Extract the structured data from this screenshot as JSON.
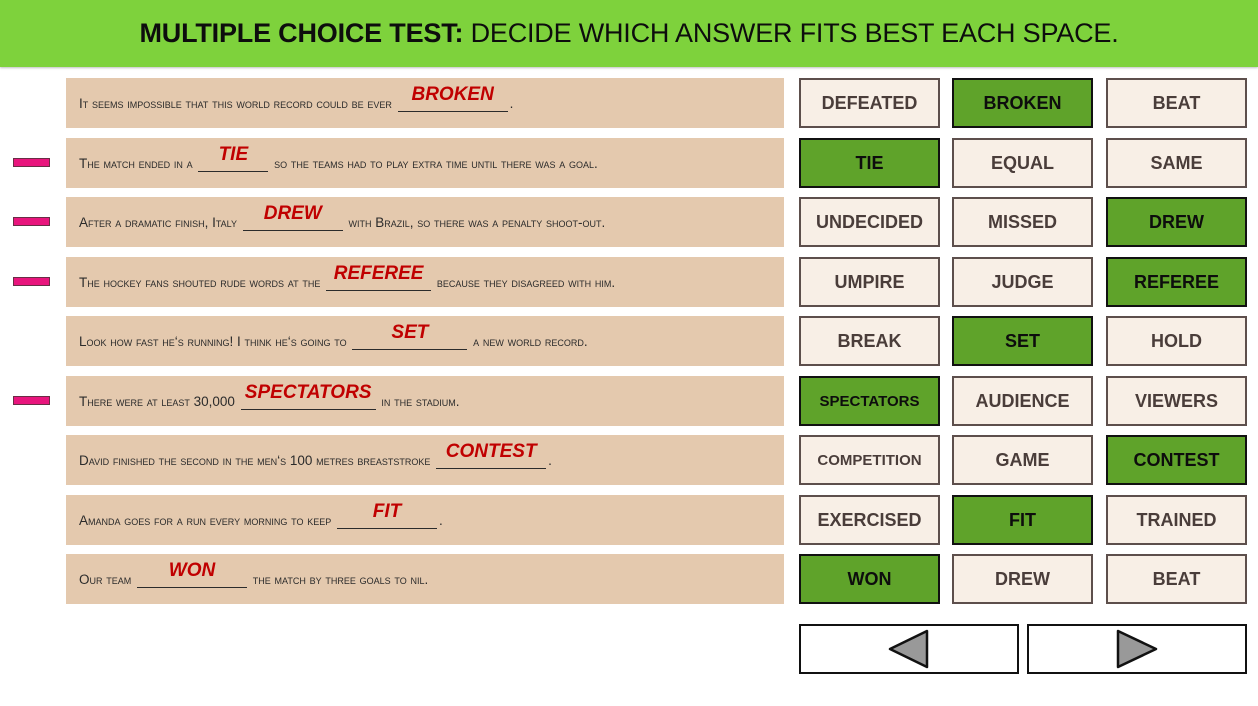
{
  "header": {
    "title_bold": "MULTIPLE CHOICE TEST:",
    "title_rest": " DECIDE WHICH ANSWER FITS BEST EACH SPACE."
  },
  "colors": {
    "header_bg": "#7ed23c",
    "question_bg": "#e4c9ae",
    "answer_text": "#c00000",
    "correct_option_bg": "#5fa32a",
    "option_bg": "#f8efe6",
    "marker": "#e8157d"
  },
  "questions": [
    {
      "before": "It seems impossible that this world record could be ever ",
      "answer": "BROKEN",
      "after": ".",
      "marked": false,
      "options": [
        {
          "label": "DEFEATED",
          "correct": false
        },
        {
          "label": "BROKEN",
          "correct": true
        },
        {
          "label": "BEAT",
          "correct": false
        }
      ]
    },
    {
      "before": "The match ended in a ",
      "answer": "TIE",
      "after": " so the teams had to play extra time until there was a goal.",
      "marked": true,
      "options": [
        {
          "label": "TIE",
          "correct": true
        },
        {
          "label": "EQUAL",
          "correct": false
        },
        {
          "label": "SAME",
          "correct": false
        }
      ]
    },
    {
      "before": "After a dramatic finish, Italy ",
      "answer": "DREW",
      "after": " with Brazil, so there was a penalty shoot-out.",
      "marked": true,
      "options": [
        {
          "label": "UNDECIDED",
          "correct": false
        },
        {
          "label": "MISSED",
          "correct": false
        },
        {
          "label": "DREW",
          "correct": true
        }
      ]
    },
    {
      "before": "The hockey fans shouted rude words at the ",
      "answer": "REFEREE",
      "after": " because they disagreed with him.",
      "marked": true,
      "options": [
        {
          "label": "UMPIRE",
          "correct": false
        },
        {
          "label": "JUDGE",
          "correct": false
        },
        {
          "label": "REFEREE",
          "correct": true
        }
      ]
    },
    {
      "before": "Look how fast he‘s running! I think he‘s going to ",
      "answer": "SET",
      "after": " a new world record.",
      "marked": false,
      "options": [
        {
          "label": "BREAK",
          "correct": false
        },
        {
          "label": "SET",
          "correct": true
        },
        {
          "label": "HOLD",
          "correct": false
        }
      ]
    },
    {
      "before": "There were at least 30,000 ",
      "answer": "SPECTATORS",
      "after": " in the stadium.",
      "marked": true,
      "options": [
        {
          "label": "SPECTATORS",
          "correct": true
        },
        {
          "label": "AUDIENCE",
          "correct": false
        },
        {
          "label": "VIEWERS",
          "correct": false
        }
      ]
    },
    {
      "before": "David finished the second in the men‘s 100 metres breaststroke ",
      "answer": "CONTEST",
      "after": ".",
      "marked": false,
      "options": [
        {
          "label": "COMPETITION",
          "correct": false
        },
        {
          "label": "GAME",
          "correct": false
        },
        {
          "label": "CONTEST",
          "correct": true
        }
      ]
    },
    {
      "before": "Amanda goes for a run every morning to keep ",
      "answer": "FIT",
      "after": ".",
      "marked": false,
      "options": [
        {
          "label": "EXERCISED",
          "correct": false
        },
        {
          "label": "FIT",
          "correct": true
        },
        {
          "label": "TRAINED",
          "correct": false
        }
      ]
    },
    {
      "before": "Our team ",
      "answer": "WON",
      "after": " the match by three goals to nil.",
      "marked": false,
      "options": [
        {
          "label": "WON",
          "correct": true
        },
        {
          "label": "DREW",
          "correct": false
        },
        {
          "label": "BEAT",
          "correct": false
        }
      ]
    }
  ],
  "navigation": {
    "prev_icon": "triangle-left-icon",
    "next_icon": "triangle-right-icon"
  }
}
